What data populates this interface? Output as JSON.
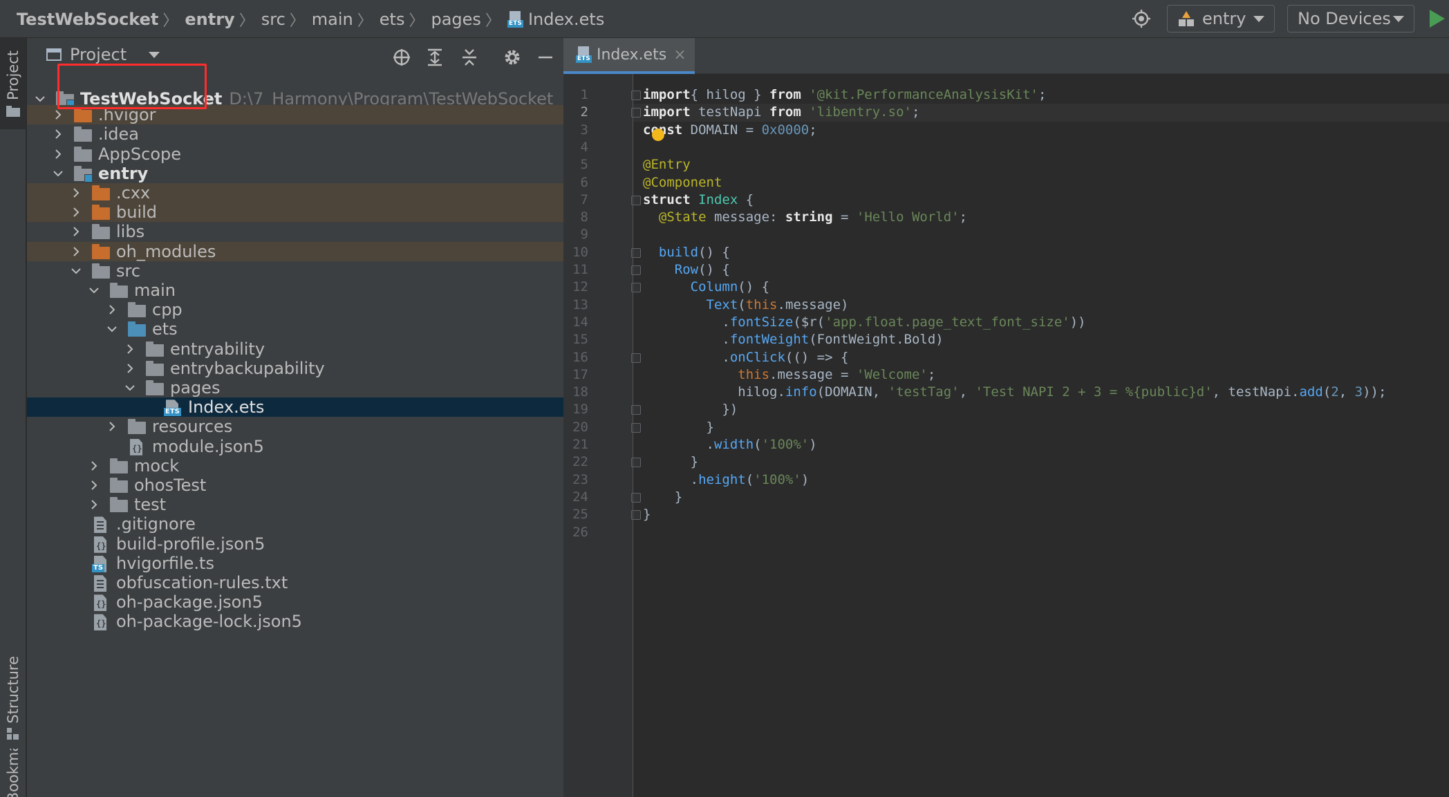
{
  "breadcrumbs": [
    {
      "label": "TestWebSocket",
      "bold": true
    },
    {
      "label": "entry",
      "bold": true
    },
    {
      "label": "src",
      "bold": false
    },
    {
      "label": "main",
      "bold": false
    },
    {
      "label": "ets",
      "bold": false
    },
    {
      "label": "pages",
      "bold": false
    }
  ],
  "breadcrumb_file": "Index.ets",
  "ets_badge": "ETS",
  "run_config": {
    "module": "entry",
    "device": "No Devices"
  },
  "left_strip": {
    "project": "Project",
    "structure": "Structure",
    "bookmarks": "Bookmarks"
  },
  "project_panel": {
    "title": "Project"
  },
  "project_root": {
    "name": "TestWebSocket",
    "path": "D:\\7_Harmony\\Program\\TestWebSocket"
  },
  "tree": [
    {
      "label": ".hvigor",
      "depth": 1,
      "chev": "right",
      "icon": "folder-orange",
      "excluded": true
    },
    {
      "label": ".idea",
      "depth": 1,
      "chev": "right",
      "icon": "folder"
    },
    {
      "label": "AppScope",
      "depth": 1,
      "chev": "right",
      "icon": "folder"
    },
    {
      "label": "entry",
      "depth": 1,
      "chev": "down",
      "icon": "folder-module",
      "bold": true
    },
    {
      "label": ".cxx",
      "depth": 2,
      "chev": "right",
      "icon": "folder-orange",
      "excluded": true
    },
    {
      "label": "build",
      "depth": 2,
      "chev": "right",
      "icon": "folder-orange",
      "excluded": true
    },
    {
      "label": "libs",
      "depth": 2,
      "chev": "right",
      "icon": "folder"
    },
    {
      "label": "oh_modules",
      "depth": 2,
      "chev": "right",
      "icon": "folder-orange",
      "excluded": true
    },
    {
      "label": "src",
      "depth": 2,
      "chev": "down",
      "icon": "folder"
    },
    {
      "label": "main",
      "depth": 3,
      "chev": "down",
      "icon": "folder"
    },
    {
      "label": "cpp",
      "depth": 4,
      "chev": "right",
      "icon": "folder"
    },
    {
      "label": "ets",
      "depth": 4,
      "chev": "down",
      "icon": "folder-blue"
    },
    {
      "label": "entryability",
      "depth": 5,
      "chev": "right",
      "icon": "folder"
    },
    {
      "label": "entrybackupability",
      "depth": 5,
      "chev": "right",
      "icon": "folder"
    },
    {
      "label": "pages",
      "depth": 5,
      "chev": "down",
      "icon": "folder"
    },
    {
      "label": "Index.ets",
      "depth": 6,
      "chev": "none",
      "icon": "file-ets",
      "selected": true
    },
    {
      "label": "resources",
      "depth": 4,
      "chev": "right",
      "icon": "folder"
    },
    {
      "label": "module.json5",
      "depth": 4,
      "chev": "none",
      "icon": "file-json"
    },
    {
      "label": "mock",
      "depth": 3,
      "chev": "right",
      "icon": "folder"
    },
    {
      "label": "ohosTest",
      "depth": 3,
      "chev": "right",
      "icon": "folder"
    },
    {
      "label": "test",
      "depth": 3,
      "chev": "right",
      "icon": "folder"
    },
    {
      "label": ".gitignore",
      "depth": 2,
      "chev": "none",
      "icon": "file-text"
    },
    {
      "label": "build-profile.json5",
      "depth": 2,
      "chev": "none",
      "icon": "file-json"
    },
    {
      "label": "hvigorfile.ts",
      "depth": 2,
      "chev": "none",
      "icon": "file-ts"
    },
    {
      "label": "obfuscation-rules.txt",
      "depth": 2,
      "chev": "none",
      "icon": "file-text"
    },
    {
      "label": "oh-package.json5",
      "depth": 2,
      "chev": "none",
      "icon": "file-json"
    },
    {
      "label": "oh-package-lock.json5",
      "depth": 2,
      "chev": "none",
      "icon": "file-json"
    }
  ],
  "editor": {
    "tab_label": "Index.ets",
    "tab_close": "×",
    "current_line": 2,
    "code_lines": [
      [
        [
          "kw",
          "import"
        ],
        [
          "",
          "{ hilog } "
        ],
        [
          "kw",
          "from"
        ],
        [
          "",
          ""
        ],
        [
          "str",
          " '@kit.PerformanceAnalysisKit'"
        ],
        [
          "",
          ";"
        ]
      ],
      [
        [
          "kw",
          "import"
        ],
        [
          "",
          " testNapi "
        ],
        [
          "kw",
          "from"
        ],
        [
          "str",
          " 'libentry.so'"
        ],
        [
          "",
          ";"
        ]
      ],
      [
        [
          "kw",
          "const"
        ],
        [
          "",
          " DOMAIN = "
        ],
        [
          "num",
          "0x0000"
        ],
        [
          "",
          ";"
        ]
      ],
      [],
      [
        [
          "ann",
          "@Entry"
        ]
      ],
      [
        [
          "ann",
          "@Component"
        ]
      ],
      [
        [
          "kw",
          "struct"
        ],
        [
          "cls",
          " Index"
        ],
        [
          "",
          " {"
        ]
      ],
      [
        [
          "",
          ""
        ],
        [
          "ann",
          "  @State"
        ],
        [
          "",
          " message: "
        ],
        [
          "kw",
          "string"
        ],
        [
          "",
          " = "
        ],
        [
          "str",
          "'Hello World'"
        ],
        [
          "",
          ";"
        ]
      ],
      [],
      [
        [
          "fn",
          "  build"
        ],
        [
          "",
          "() {"
        ]
      ],
      [
        [
          "fn",
          "    Row"
        ],
        [
          "",
          "() {"
        ]
      ],
      [
        [
          "fn",
          "      Column"
        ],
        [
          "",
          "() {"
        ]
      ],
      [
        [
          "fn",
          "        Text"
        ],
        [
          "",
          "("
        ],
        [
          "kw",
          "this"
        ],
        [
          "",
          ".message)"
        ]
      ],
      [
        [
          "",
          "          ."
        ],
        [
          "fn",
          "fontSize"
        ],
        [
          "",
          "($r("
        ],
        [
          "str",
          "'app.float.page_text_font_size'"
        ],
        [
          "",
          "))"
        ]
      ],
      [
        [
          "",
          "          ."
        ],
        [
          "fn",
          "fontWeight"
        ],
        [
          "",
          "(FontWeight.Bold)"
        ]
      ],
      [
        [
          "",
          "          ."
        ],
        [
          "fn",
          "onClick"
        ],
        [
          "",
          "(() => {"
        ]
      ],
      [
        [
          "kw",
          "            this"
        ],
        [
          "",
          ".message = "
        ],
        [
          "str",
          "'Welcome'"
        ],
        [
          "",
          ";"
        ]
      ],
      [
        [
          "",
          "            hilog."
        ],
        [
          "fn",
          "info"
        ],
        [
          "",
          "(DOMAIN, "
        ],
        [
          "str",
          "'testTag'"
        ],
        [
          "",
          ", "
        ],
        [
          "str",
          "'Test NAPI 2 + 3 = %{public}d'"
        ],
        [
          "",
          ", testNapi."
        ],
        [
          "fn",
          "add"
        ],
        [
          "",
          "("
        ],
        [
          "num",
          "2"
        ],
        [
          "",
          ", "
        ],
        [
          "num",
          "3"
        ],
        [
          "",
          "));"
        ]
      ],
      [
        [
          "",
          "          })"
        ]
      ],
      [
        [
          "",
          "        }"
        ]
      ],
      [
        [
          "",
          "        ."
        ],
        [
          "fn",
          "width"
        ],
        [
          "",
          "("
        ],
        [
          "str",
          "'100%'"
        ],
        [
          "",
          ")"
        ]
      ],
      [
        [
          "",
          "      }"
        ]
      ],
      [
        [
          "",
          "      ."
        ],
        [
          "fn",
          "height"
        ],
        [
          "",
          "("
        ],
        [
          "str",
          "'100%'"
        ],
        [
          "",
          ")"
        ]
      ],
      [
        [
          "",
          "    }"
        ]
      ],
      [
        [
          "",
          "}"
        ]
      ],
      []
    ]
  }
}
